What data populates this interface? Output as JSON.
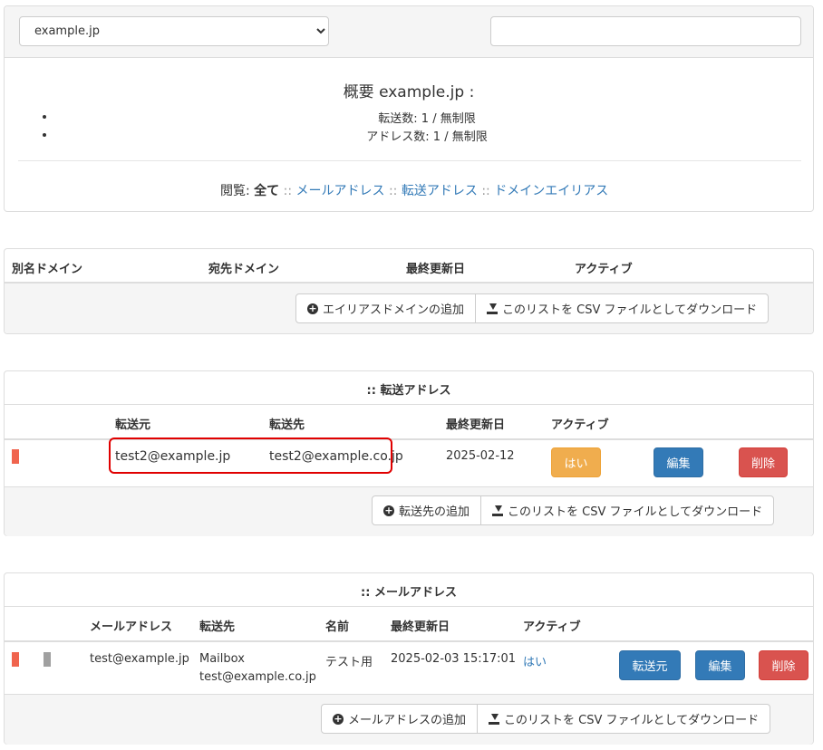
{
  "top": {
    "domain_select": "example.jp",
    "search_value": ""
  },
  "overview": {
    "title": "概要 example.jp :",
    "items": [
      "転送数: 1 / 無制限",
      "アドレス数: 1 / 無制限"
    ],
    "browse_label": "閲覧:",
    "browse_all": "全て",
    "sep": "::",
    "links": [
      "メールアドレス",
      "転送アドレス",
      "ドメインエイリアス"
    ]
  },
  "alias_domains": {
    "headers": [
      "別名ドメイン",
      "宛先ドメイン",
      "最終更新日",
      "アクティブ"
    ],
    "add_button": "エイリアスドメインの追加",
    "csv_button": "このリストを CSV ファイルとしてダウンロード"
  },
  "forwarding": {
    "title": ":: 転送アドレス",
    "headers": [
      "転送元",
      "転送先",
      "最終更新日",
      "アクティブ"
    ],
    "rows": [
      {
        "from": "test2@example.jp",
        "to": "test2@example.co.jp",
        "updated": "2025-02-12",
        "active": "はい",
        "edit": "編集",
        "delete": "削除"
      }
    ],
    "add_button": "転送先の追加",
    "csv_button": "このリストを CSV ファイルとしてダウンロード"
  },
  "mailboxes": {
    "title": ":: メールアドレス",
    "headers": [
      "メールアドレス",
      "転送先",
      "名前",
      "最終更新日",
      "アクティブ"
    ],
    "rows": [
      {
        "address": "test@example.jp",
        "forward_line1": "Mailbox",
        "forward_line2": "test@example.co.jp",
        "name": "テスト用",
        "updated": "2025-02-03 15:17:01",
        "active": "はい",
        "forward_btn": "転送元",
        "edit": "編集",
        "delete": "削除"
      }
    ],
    "add_button": "メールアドレスの追加",
    "csv_button": "このリストを CSV ファイルとしてダウンロード"
  },
  "colors": {
    "link": "#337ab7",
    "warning": "#f0ad4e",
    "primary": "#337ab7",
    "danger": "#d9534f",
    "marker_red": "#f0644e",
    "marker_gray": "#a0a0a0",
    "highlight": "#e00000"
  }
}
